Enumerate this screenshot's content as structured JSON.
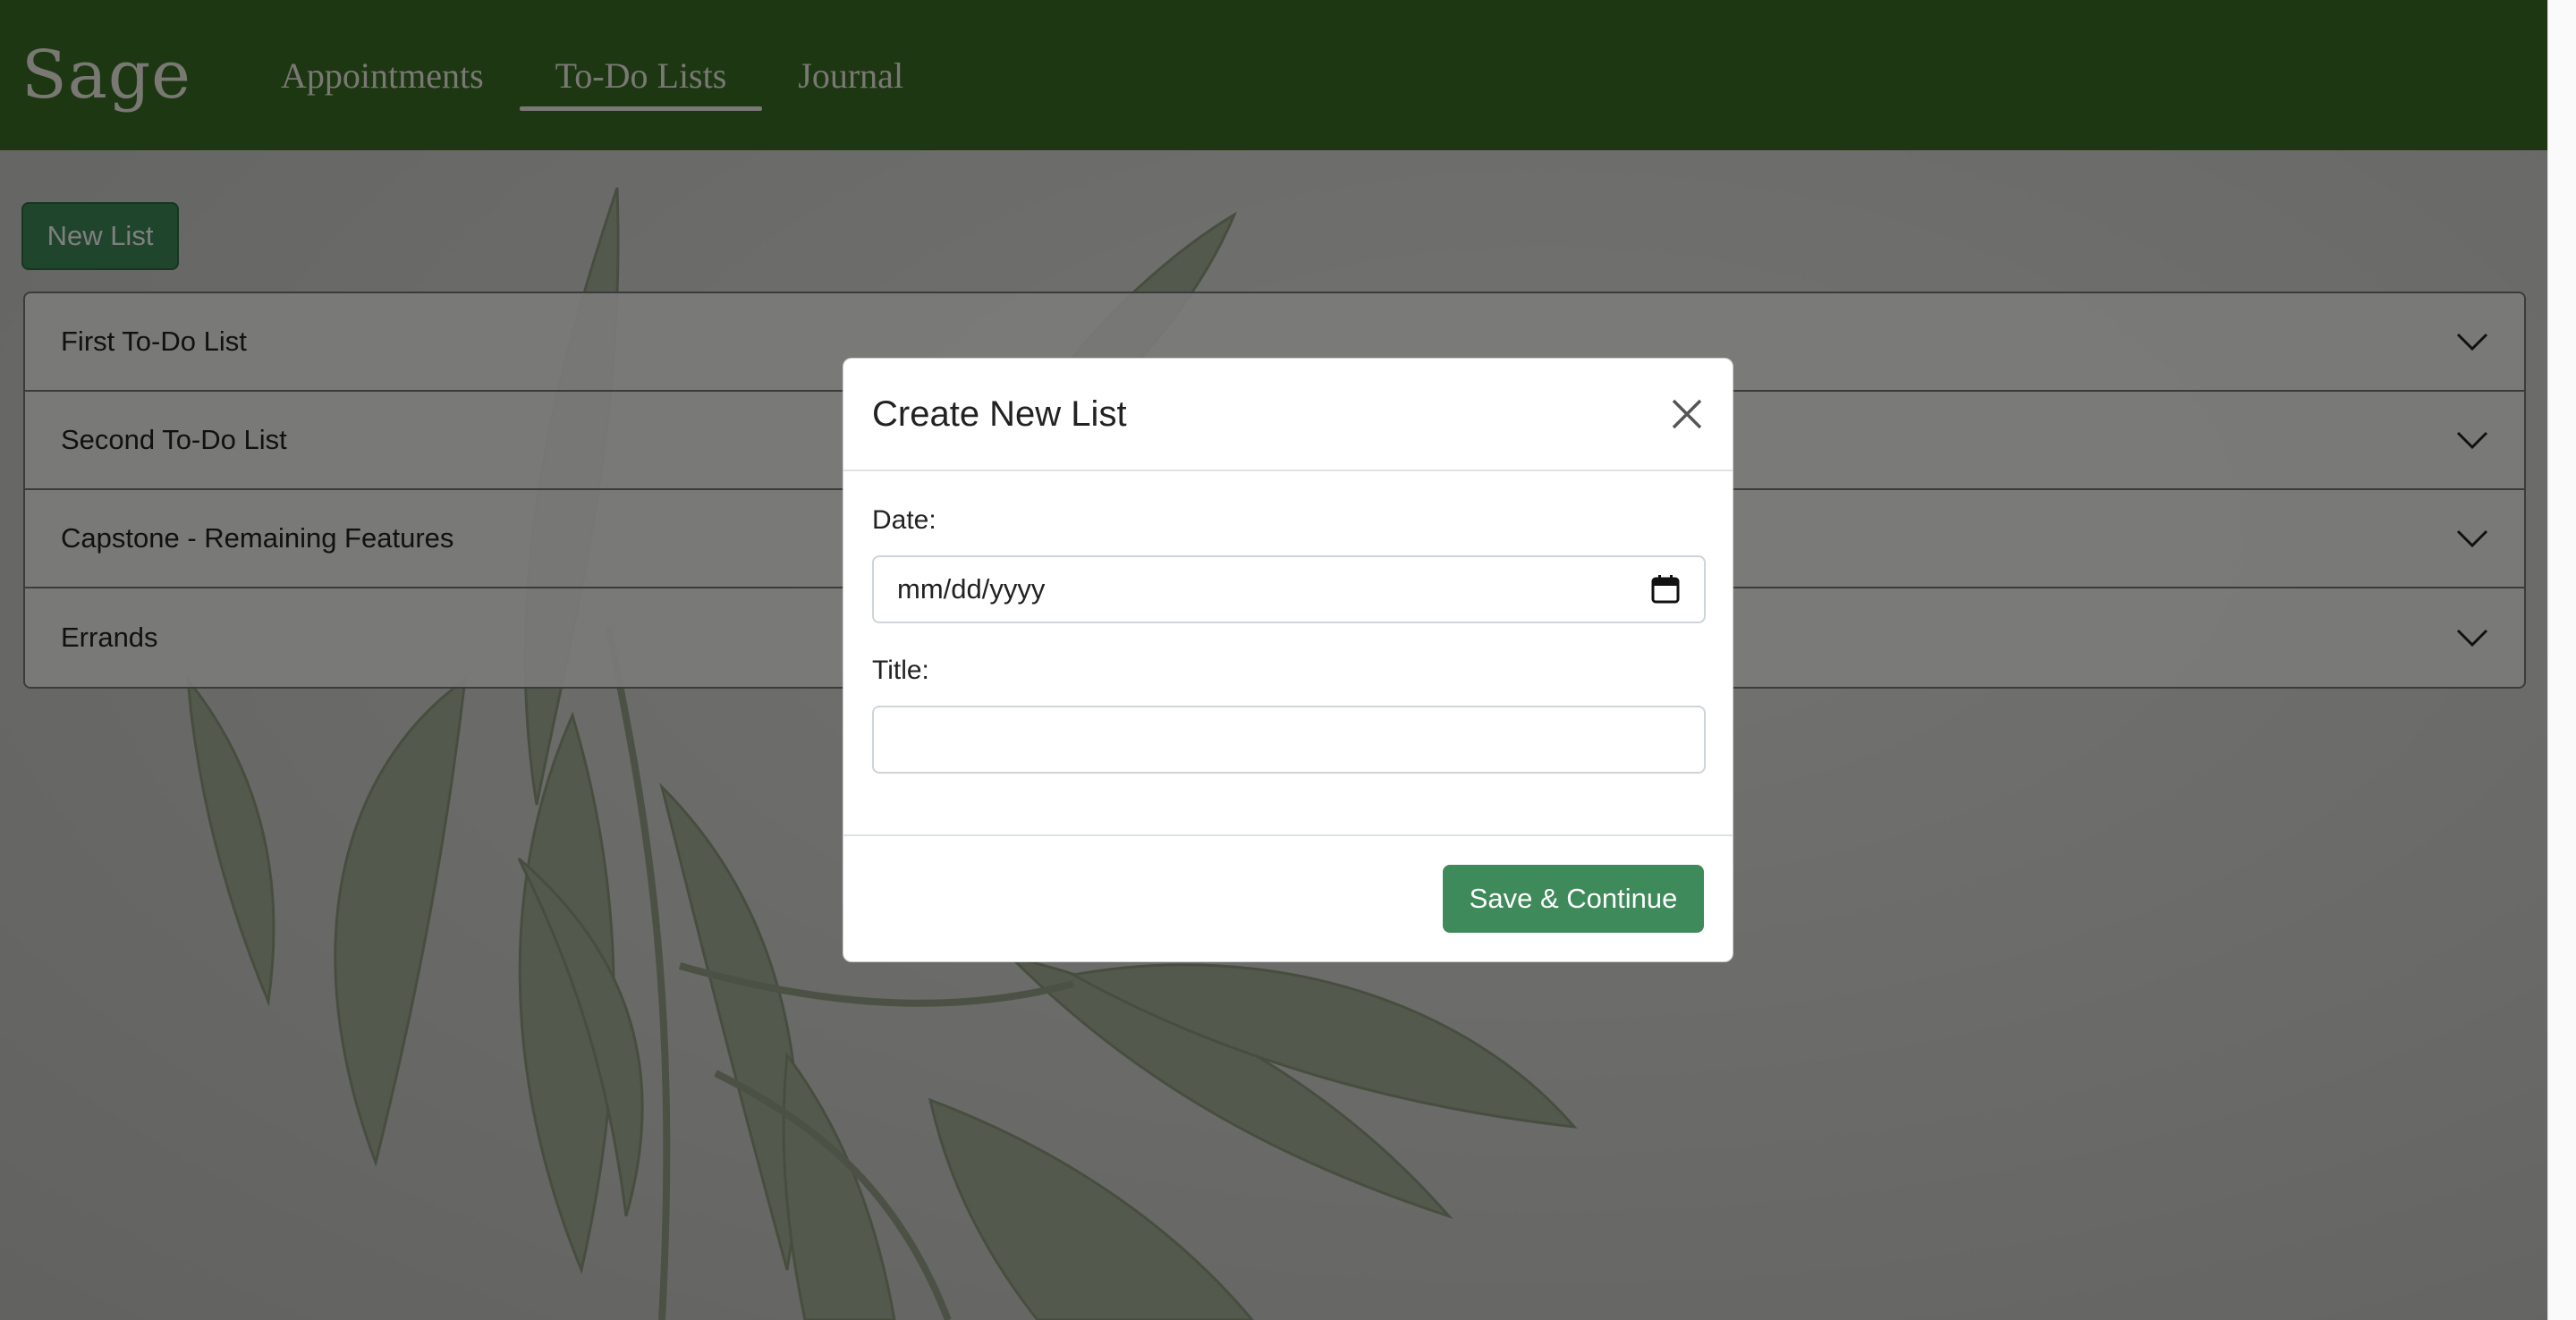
{
  "navbar": {
    "brand": "Sage",
    "links": [
      {
        "label": "Appointments",
        "active": false
      },
      {
        "label": "To-Do Lists",
        "active": true
      },
      {
        "label": "Journal",
        "active": false
      }
    ]
  },
  "content": {
    "new_list_label": "New List",
    "lists": [
      {
        "title": "First To-Do List"
      },
      {
        "title": "Second To-Do List"
      },
      {
        "title": "Capstone - Remaining Features"
      },
      {
        "title": "Errands"
      }
    ]
  },
  "modal": {
    "title": "Create New List",
    "date_label": "Date:",
    "date_placeholder": "mm/dd/yyyy",
    "title_label": "Title:",
    "title_value": "",
    "save_label": "Save & Continue"
  },
  "colors": {
    "navbar": "#3b6e24",
    "accent_button": "#3f8a5a",
    "overlay": "rgba(0,0,0,0.5)"
  }
}
